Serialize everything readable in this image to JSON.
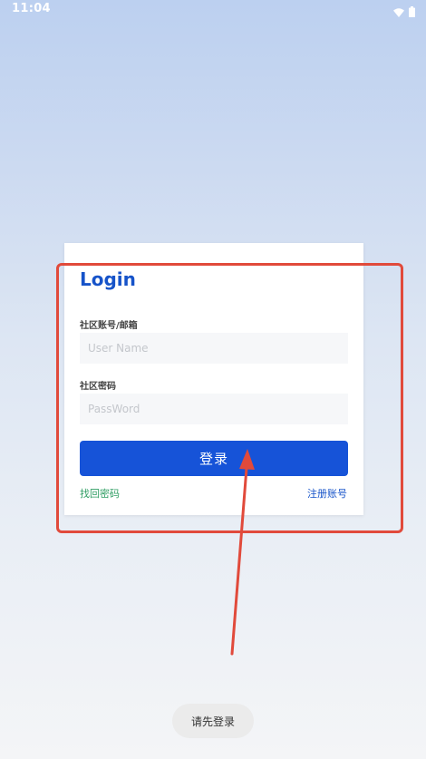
{
  "status_bar": {
    "time": "11:04",
    "icons": [
      "wifi-icon",
      "battery-icon"
    ]
  },
  "login": {
    "title": "Login",
    "username_label": "社区账号/邮箱",
    "username_placeholder": "User Name",
    "username_value": "",
    "password_label": "社区密码",
    "password_placeholder": "PassWord",
    "password_value": "",
    "submit_label": "登录",
    "forgot_link": "找回密码",
    "register_link": "注册账号"
  },
  "toast": {
    "message": "请先登录"
  },
  "colors": {
    "primary": "#1653d8",
    "title": "#1653c9",
    "forgot_link": "#2e9d62",
    "annotation": "#e14a3b"
  }
}
